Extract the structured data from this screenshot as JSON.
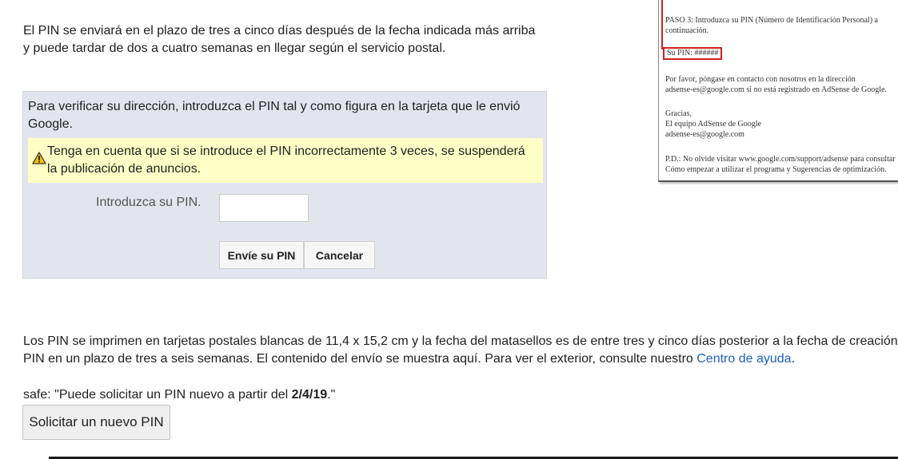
{
  "intro": {
    "line1": "El PIN se enviará en el plazo de tres a cinco días después de la fecha indicada más arriba",
    "line2": "y puede tardar de dos a cuatro semanas en llegar según el servicio postal."
  },
  "verify": {
    "instructions": "Para verificar su dirección, introduzca el PIN tal y como figura en la tarjeta que le envió Google.",
    "warning": "Tenga en cuenta que si se introduce el PIN incorrectamente 3 veces, se suspenderá la publicación de anuncios.",
    "pin_label": "Introduzca su PIN.",
    "pin_value": "",
    "send_button": "Envíe su PIN",
    "cancel_button": "Cancelar"
  },
  "card": {
    "step_line1": "PASO 3: Introduzca su PIN (Número de Identificación Personal) a",
    "step_line2": "continuación.",
    "pin_line": "Su PIN: ######",
    "contact_line1": "Por favor, póngase en contacto con nosotros en la dirección",
    "contact_line2": "adsense-es@google.com si no está registrado en AdSense de Google.",
    "thanks_line1": "Gracias,",
    "thanks_line2": "El equipo AdSense de Google",
    "thanks_line3": "adsense-es@google.com",
    "ps_line1": "P.D.: No olvide visitar www.google.com/support/adsense para consultar",
    "ps_line2": "Cómo empezar a utilizar el programa y Sugerencias de optimización."
  },
  "postal": {
    "line1": "Los PIN se imprimen en tarjetas postales blancas de 11,4 x 15,2 cm y la fecha del matasellos es de entre tres y cinco días posterior a la fecha de creación.",
    "line2_before": "PIN en un plazo de tres a seis semanas. El contenido del envío se muestra aquí. Para ver el exterior, consulte nuestro ",
    "help_link": "Centro de ayuda",
    "line2_after": "."
  },
  "safe": {
    "prefix": "safe: \"Puede solicitar un PIN nuevo a partir del ",
    "date": "2/4/19",
    "suffix": ".\""
  },
  "request_button": "Solicitar un nuevo PIN",
  "colors": {
    "panel_bg": "#e3e5ee",
    "warning_bg": "#ffffc6",
    "link": "#1a62c4",
    "card_highlight": "#d41f1f"
  },
  "icons": {
    "warning": "warning-triangle-icon"
  }
}
